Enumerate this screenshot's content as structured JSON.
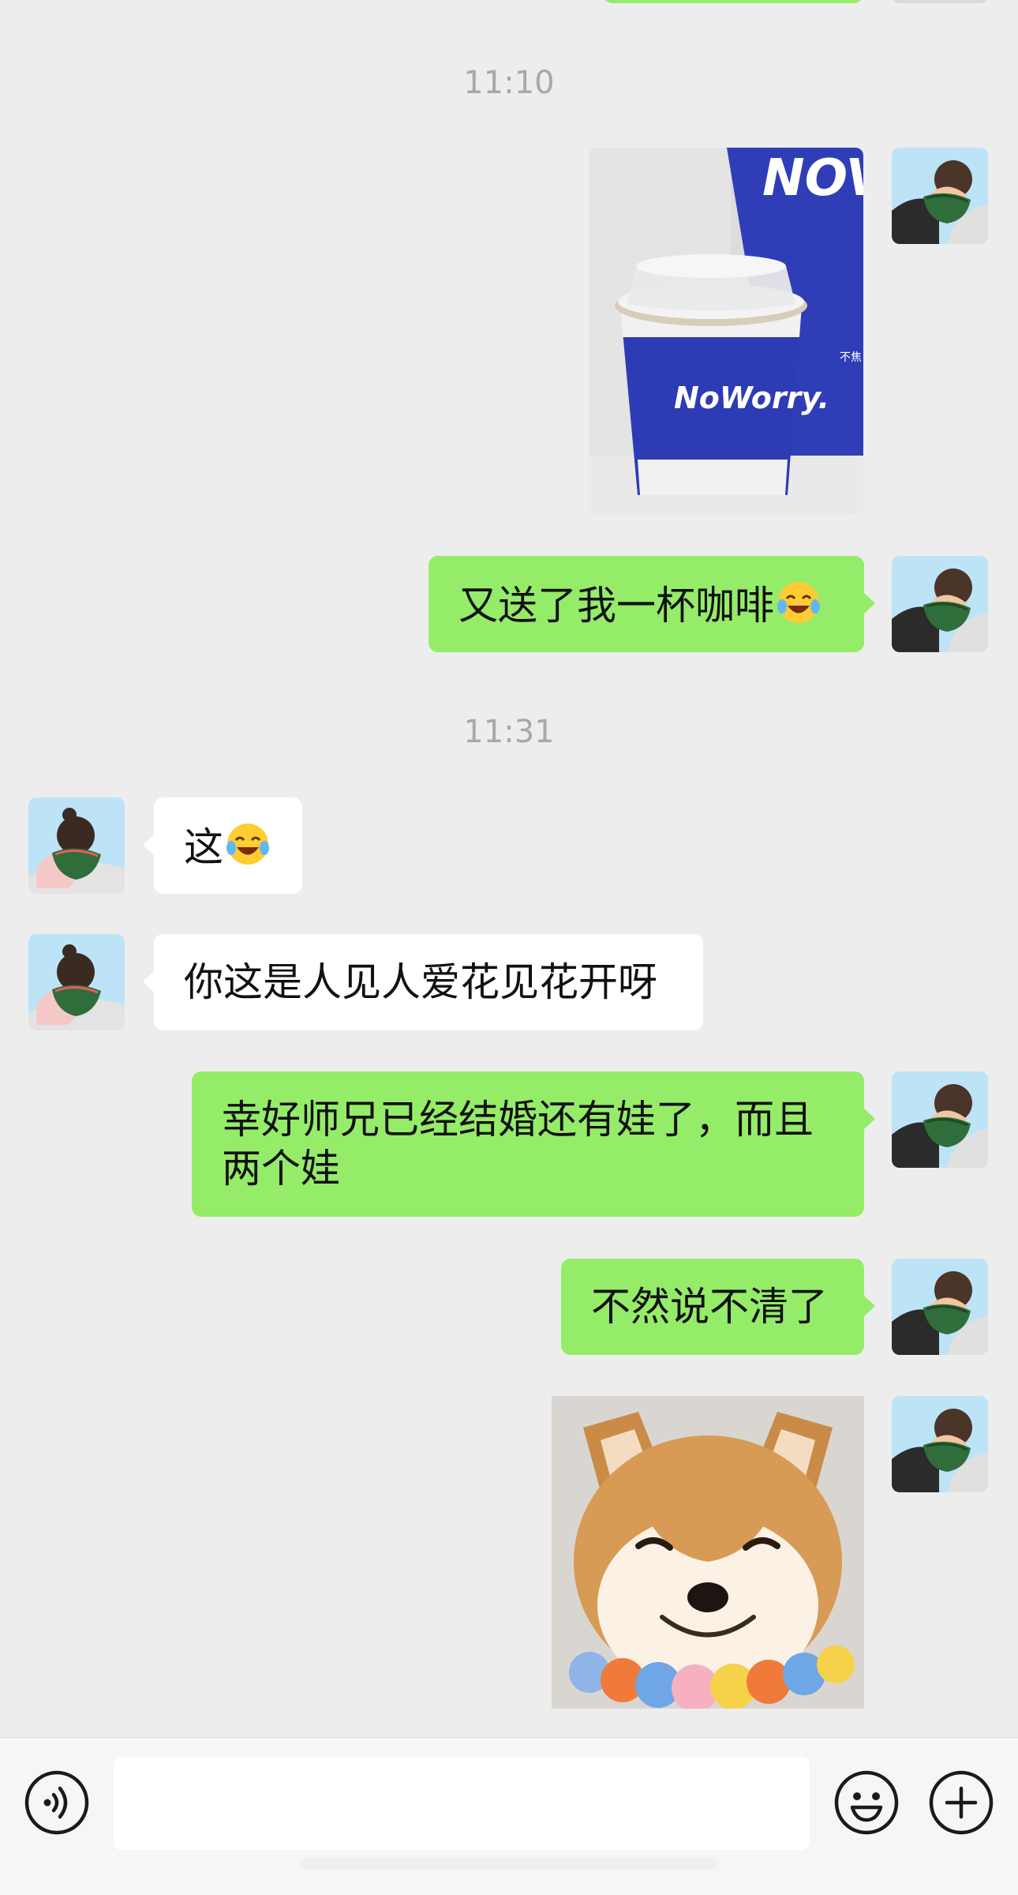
{
  "colors": {
    "background": "#ededed",
    "bubble_self": "#95ec69",
    "bubble_other": "#ffffff",
    "timestamp": "#a8a8a8"
  },
  "messages": {
    "time_1": "11:10",
    "msg_photo_coffee": {
      "sender": "self",
      "type": "image",
      "image_text": "NoWorry."
    },
    "msg_coffee": {
      "sender": "self",
      "text": "又送了我一杯咖啡",
      "emoji": "tears-of-joy-emoji"
    },
    "time_2": "11:31",
    "msg_zhe": {
      "sender": "other",
      "text": "这",
      "emoji": "tears-of-joy-emoji"
    },
    "msg_love": {
      "sender": "other",
      "text": "你这是人见人爱花见花开呀"
    },
    "msg_married_line1": "幸好师兄已经结婚还有娃了，而且",
    "msg_married_line2": "两个娃",
    "msg_unclear": {
      "sender": "self",
      "text": "不然说不清了"
    },
    "msg_sticker_dog": {
      "sender": "self",
      "type": "sticker",
      "description": "smiling-shiba-dog"
    }
  },
  "input_bar": {
    "voice_icon": "voice-icon",
    "text_value": "",
    "emoji_icon": "emoji-face-icon",
    "plus_icon": "plus-icon"
  }
}
